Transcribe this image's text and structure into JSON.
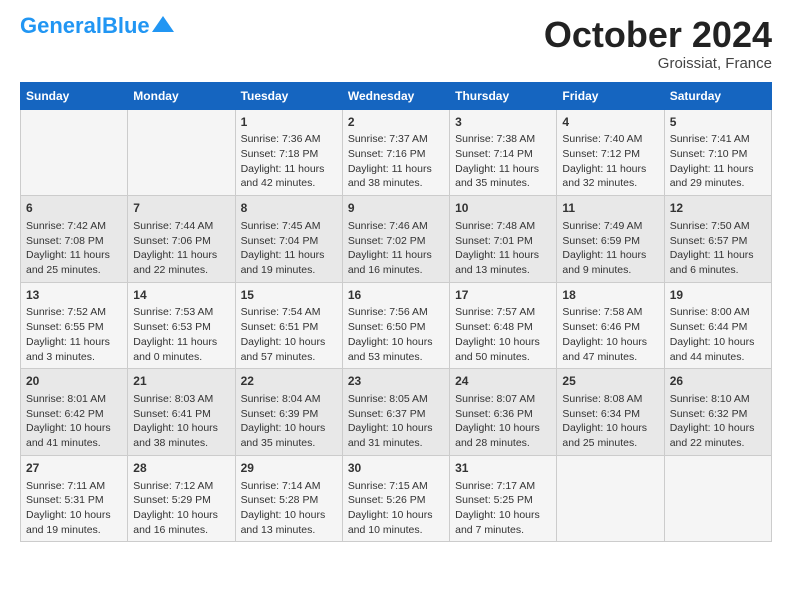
{
  "header": {
    "logo_general": "General",
    "logo_blue": "Blue",
    "month_title": "October 2024",
    "location": "Groissiat, France"
  },
  "days_of_week": [
    "Sunday",
    "Monday",
    "Tuesday",
    "Wednesday",
    "Thursday",
    "Friday",
    "Saturday"
  ],
  "weeks": [
    [
      {
        "day": "",
        "info": ""
      },
      {
        "day": "",
        "info": ""
      },
      {
        "day": "1",
        "info": "Sunrise: 7:36 AM\nSunset: 7:18 PM\nDaylight: 11 hours and 42 minutes."
      },
      {
        "day": "2",
        "info": "Sunrise: 7:37 AM\nSunset: 7:16 PM\nDaylight: 11 hours and 38 minutes."
      },
      {
        "day": "3",
        "info": "Sunrise: 7:38 AM\nSunset: 7:14 PM\nDaylight: 11 hours and 35 minutes."
      },
      {
        "day": "4",
        "info": "Sunrise: 7:40 AM\nSunset: 7:12 PM\nDaylight: 11 hours and 32 minutes."
      },
      {
        "day": "5",
        "info": "Sunrise: 7:41 AM\nSunset: 7:10 PM\nDaylight: 11 hours and 29 minutes."
      }
    ],
    [
      {
        "day": "6",
        "info": "Sunrise: 7:42 AM\nSunset: 7:08 PM\nDaylight: 11 hours and 25 minutes."
      },
      {
        "day": "7",
        "info": "Sunrise: 7:44 AM\nSunset: 7:06 PM\nDaylight: 11 hours and 22 minutes."
      },
      {
        "day": "8",
        "info": "Sunrise: 7:45 AM\nSunset: 7:04 PM\nDaylight: 11 hours and 19 minutes."
      },
      {
        "day": "9",
        "info": "Sunrise: 7:46 AM\nSunset: 7:02 PM\nDaylight: 11 hours and 16 minutes."
      },
      {
        "day": "10",
        "info": "Sunrise: 7:48 AM\nSunset: 7:01 PM\nDaylight: 11 hours and 13 minutes."
      },
      {
        "day": "11",
        "info": "Sunrise: 7:49 AM\nSunset: 6:59 PM\nDaylight: 11 hours and 9 minutes."
      },
      {
        "day": "12",
        "info": "Sunrise: 7:50 AM\nSunset: 6:57 PM\nDaylight: 11 hours and 6 minutes."
      }
    ],
    [
      {
        "day": "13",
        "info": "Sunrise: 7:52 AM\nSunset: 6:55 PM\nDaylight: 11 hours and 3 minutes."
      },
      {
        "day": "14",
        "info": "Sunrise: 7:53 AM\nSunset: 6:53 PM\nDaylight: 11 hours and 0 minutes."
      },
      {
        "day": "15",
        "info": "Sunrise: 7:54 AM\nSunset: 6:51 PM\nDaylight: 10 hours and 57 minutes."
      },
      {
        "day": "16",
        "info": "Sunrise: 7:56 AM\nSunset: 6:50 PM\nDaylight: 10 hours and 53 minutes."
      },
      {
        "day": "17",
        "info": "Sunrise: 7:57 AM\nSunset: 6:48 PM\nDaylight: 10 hours and 50 minutes."
      },
      {
        "day": "18",
        "info": "Sunrise: 7:58 AM\nSunset: 6:46 PM\nDaylight: 10 hours and 47 minutes."
      },
      {
        "day": "19",
        "info": "Sunrise: 8:00 AM\nSunset: 6:44 PM\nDaylight: 10 hours and 44 minutes."
      }
    ],
    [
      {
        "day": "20",
        "info": "Sunrise: 8:01 AM\nSunset: 6:42 PM\nDaylight: 10 hours and 41 minutes."
      },
      {
        "day": "21",
        "info": "Sunrise: 8:03 AM\nSunset: 6:41 PM\nDaylight: 10 hours and 38 minutes."
      },
      {
        "day": "22",
        "info": "Sunrise: 8:04 AM\nSunset: 6:39 PM\nDaylight: 10 hours and 35 minutes."
      },
      {
        "day": "23",
        "info": "Sunrise: 8:05 AM\nSunset: 6:37 PM\nDaylight: 10 hours and 31 minutes."
      },
      {
        "day": "24",
        "info": "Sunrise: 8:07 AM\nSunset: 6:36 PM\nDaylight: 10 hours and 28 minutes."
      },
      {
        "day": "25",
        "info": "Sunrise: 8:08 AM\nSunset: 6:34 PM\nDaylight: 10 hours and 25 minutes."
      },
      {
        "day": "26",
        "info": "Sunrise: 8:10 AM\nSunset: 6:32 PM\nDaylight: 10 hours and 22 minutes."
      }
    ],
    [
      {
        "day": "27",
        "info": "Sunrise: 7:11 AM\nSunset: 5:31 PM\nDaylight: 10 hours and 19 minutes."
      },
      {
        "day": "28",
        "info": "Sunrise: 7:12 AM\nSunset: 5:29 PM\nDaylight: 10 hours and 16 minutes."
      },
      {
        "day": "29",
        "info": "Sunrise: 7:14 AM\nSunset: 5:28 PM\nDaylight: 10 hours and 13 minutes."
      },
      {
        "day": "30",
        "info": "Sunrise: 7:15 AM\nSunset: 5:26 PM\nDaylight: 10 hours and 10 minutes."
      },
      {
        "day": "31",
        "info": "Sunrise: 7:17 AM\nSunset: 5:25 PM\nDaylight: 10 hours and 7 minutes."
      },
      {
        "day": "",
        "info": ""
      },
      {
        "day": "",
        "info": ""
      }
    ]
  ]
}
